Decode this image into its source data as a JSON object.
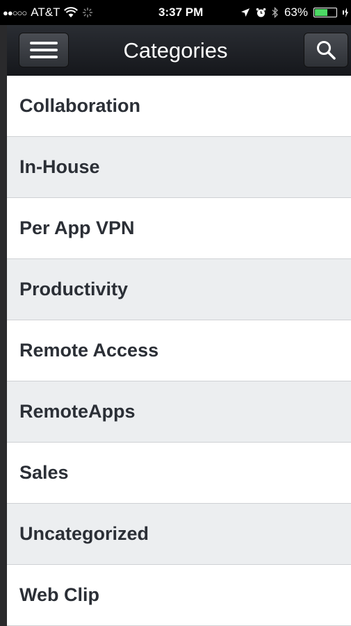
{
  "status_bar": {
    "carrier": "AT&T",
    "signal": "●●○○○",
    "time": "3:37 PM",
    "battery_percent": "63%",
    "battery_level": 0.63
  },
  "nav": {
    "title": "Categories"
  },
  "categories": [
    "Collaboration",
    "In-House",
    "Per App VPN",
    "Productivity",
    "Remote Access",
    "RemoteApps",
    "Sales",
    "Uncategorized",
    "Web Clip"
  ],
  "colors": {
    "battery": "#4cd964",
    "row_alt": "#eceef0",
    "text": "#2b2f36"
  }
}
